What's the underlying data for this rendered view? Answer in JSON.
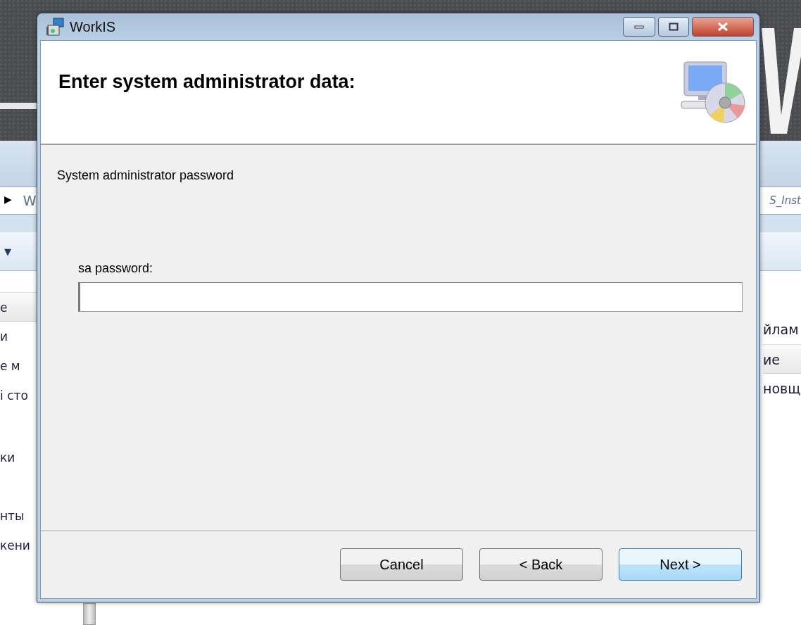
{
  "background_window": {
    "breadcrumb_arrow": "▶",
    "breadcrumb": "W",
    "path_end": "S_Inst",
    "toolbar_caret": "▾",
    "left_items": [
      {
        "text": "е",
        "kind": "header"
      },
      {
        "text": "и",
        "kind": "item"
      },
      {
        "text": "е м",
        "kind": "item"
      },
      {
        "text": "і сто",
        "kind": "item"
      },
      {
        "text": "ки",
        "kind": "item"
      },
      {
        "text": "нты",
        "kind": "item"
      },
      {
        "text": "кени",
        "kind": "item"
      }
    ],
    "right_items": [
      {
        "text": "йлам",
        "kind": "item"
      },
      {
        "text": "ие",
        "kind": "header"
      },
      {
        "text": "новщ",
        "kind": "item"
      }
    ]
  },
  "dialog": {
    "title": "WorkIS",
    "heading": "Enter system administrator data:",
    "section_label": "System administrator password",
    "field": {
      "label": "sa password:"
    },
    "buttons": [
      {
        "label": "Cancel",
        "default": false
      },
      {
        "label": "< Back",
        "default": false
      },
      {
        "label": "Next >",
        "default": true
      }
    ]
  }
}
